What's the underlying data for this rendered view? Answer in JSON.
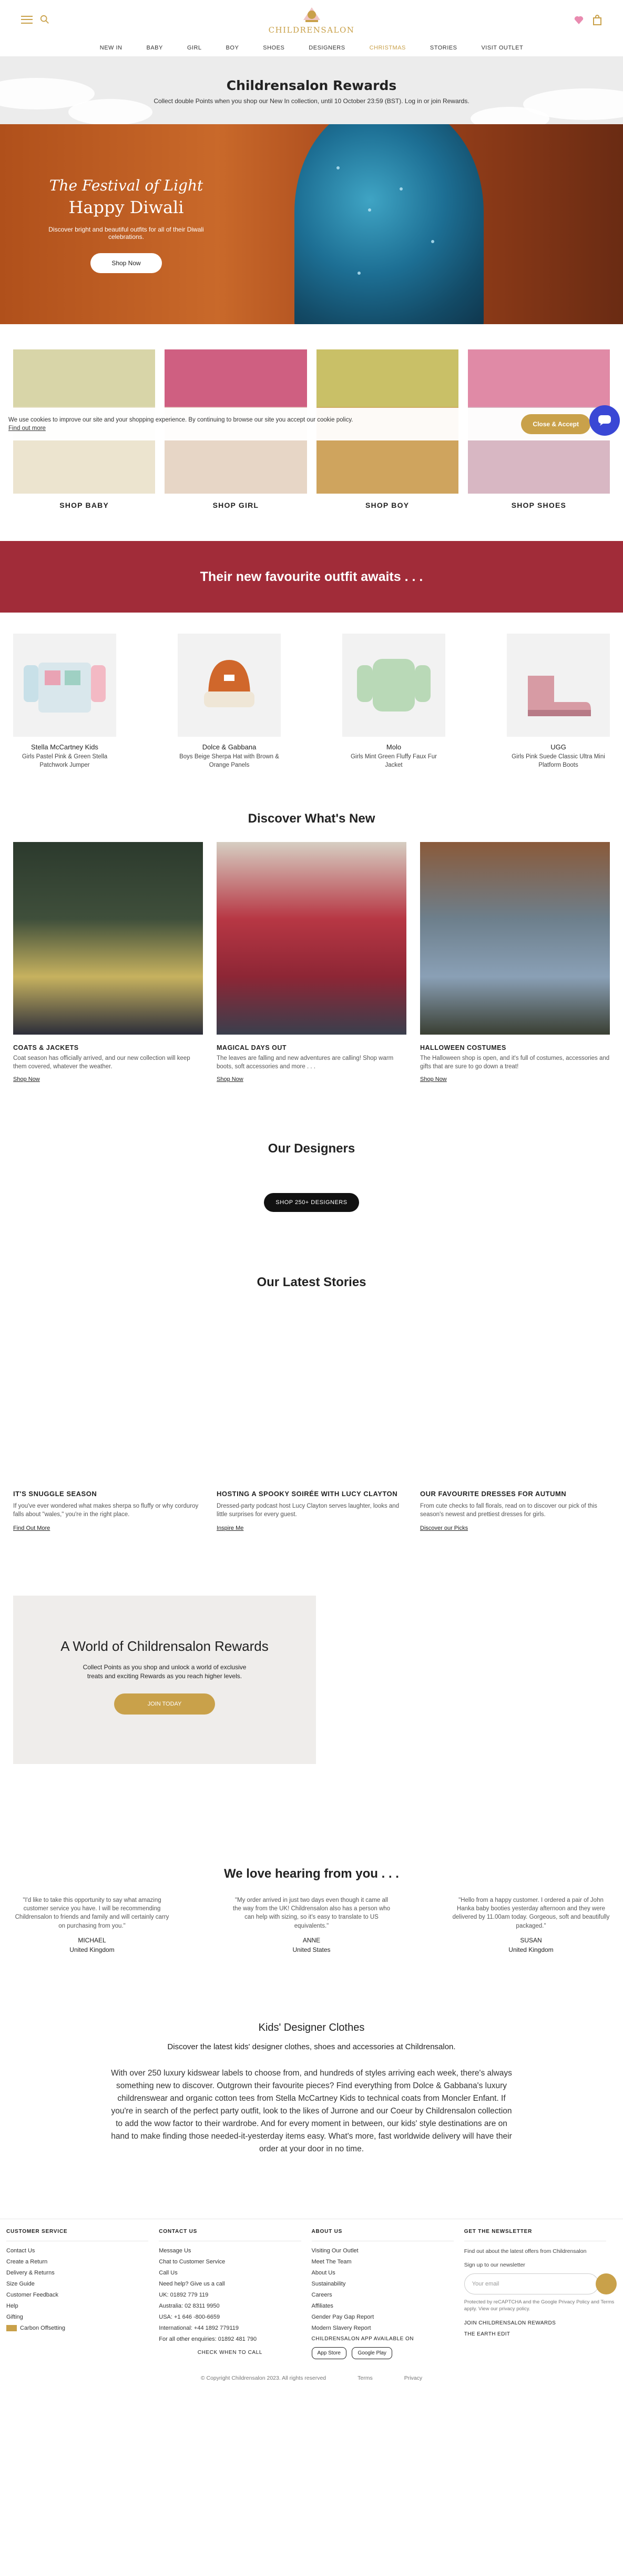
{
  "header": {
    "brand": "CHILDRENSALON",
    "nav": [
      "NEW IN",
      "BABY",
      "GIRL",
      "BOY",
      "SHOES",
      "DESIGNERS",
      "CHRISTMAS",
      "STORIES",
      "VISIT OUTLET"
    ],
    "icons": [
      "menu-icon",
      "search-icon",
      "wishlist-icon",
      "bag-icon"
    ]
  },
  "rewards_banner": {
    "title": "Childrensalon Rewards",
    "text": "Collect double Points when you shop our New In collection, until 10 October 23:59 (BST). Log in or join Rewards."
  },
  "hero": {
    "script": "The Festival of Light",
    "title": "Happy Diwali",
    "text": "Discover bright and beautiful outfits for all of their Diwali celebrations.",
    "button": "Shop Now"
  },
  "categories": [
    {
      "label": "SHOP BABY",
      "color": "#e6d9b8"
    },
    {
      "label": "SHOP GIRL",
      "color": "#d96a8a"
    },
    {
      "label": "SHOP BOY",
      "color": "#cfb455"
    },
    {
      "label": "SHOP SHOES",
      "color": "#e889a8"
    }
  ],
  "cookie": {
    "text": "We use cookies to improve our site and your shopping experience. By continuing to browse our site you accept our cookie policy.",
    "link": "Find out more",
    "button": "Close & Accept"
  },
  "outfit_band": {
    "title": "Their new favourite outfit awaits . . ."
  },
  "products": [
    {
      "brand": "Stella McCartney Kids",
      "name": "Girls Pastel Pink & Green Stella Patchwork Jumper"
    },
    {
      "brand": "Dolce & Gabbana",
      "name": "Boys Beige Sherpa Hat with Brown & Orange Panels"
    },
    {
      "brand": "Molo",
      "name": "Girls Mint Green Fluffy Faux Fur Jacket"
    },
    {
      "brand": "UGG",
      "name": "Girls Pink Suede Classic Ultra Mini Platform Boots"
    }
  ],
  "discover": {
    "title": "Discover What's New",
    "cards": [
      {
        "title": "COATS & JACKETS",
        "text": "Coat season has officially arrived, and our new collection will keep them covered, whatever the weather.",
        "link": "Shop Now"
      },
      {
        "title": "MAGICAL DAYS OUT",
        "text": "The leaves are falling and new adventures are calling! Shop warm boots, soft accessories and more . . .",
        "link": "Shop Now"
      },
      {
        "title": "HALLOWEEN COSTUMES",
        "text": "The Halloween shop is open, and it's full of costumes, accessories and gifts that are sure to go down a treat!",
        "link": "Shop Now"
      }
    ]
  },
  "designers": {
    "title": "Our Designers",
    "button": "SHOP 250+ DESIGNERS"
  },
  "stories": {
    "title": "Our Latest Stories",
    "items": [
      {
        "title": "IT'S SNUGGLE SEASON",
        "text": "If you've ever wondered what makes sherpa so fluffy or why corduroy falls about \"wales,\" you're in the right place.",
        "link": "Find Out More"
      },
      {
        "title": "HOSTING A SPOOKY SOIRÉE WITH LUCY CLAYTON",
        "text": "Dressed-party podcast host Lucy Clayton serves laughter, looks and little surprises for every guest.",
        "link": "Inspire Me"
      },
      {
        "title": "OUR FAVOURITE DRESSES FOR AUTUMN",
        "text": "From cute checks to fall florals, read on to discover our pick of this season's newest and prettiest dresses for girls.",
        "link": "Discover our Picks"
      }
    ]
  },
  "world": {
    "title": "A World of Childrensalon Rewards",
    "text": "Collect Points as you shop and unlock a world of exclusive treats and exciting Rewards as you reach higher levels.",
    "button": "JOIN TODAY"
  },
  "testimonials": {
    "title": "We love hearing from you . . .",
    "items": [
      {
        "quote": "\"I'd like to take this opportunity to say what amazing customer service you have. I will be recommending Childrensalon to friends and family and will certainly carry on purchasing from you.\"",
        "name": "MICHAEL",
        "place": "United Kingdom"
      },
      {
        "quote": "\"My order arrived in just two days even though it came all the way from the UK! Childrensalon also has a person who can help with sizing, so it's easy to translate to US equivalents.\"",
        "name": "ANNE",
        "place": "United States"
      },
      {
        "quote": "\"Hello from a happy customer. I ordered a pair of John Hanka baby booties yesterday afternoon and they were delivered by 11.00am today. Gorgeous, soft and beautifully packaged.\"",
        "name": "SUSAN",
        "place": "United Kingdom"
      }
    ]
  },
  "seo": {
    "title": "Kids' Designer Clothes",
    "sub": "Discover the latest kids' designer clothes, shoes and accessories at Childrensalon.",
    "body": "With over 250 luxury kidswear labels to choose from, and hundreds of styles arriving each week, there's always something new to discover. Outgrown their favourite pieces? Find everything from Dolce & Gabbana's luxury childrenswear and organic cotton tees from Stella McCartney Kids to technical coats from Moncler Enfant. If you're in search of the perfect party outfit, look to the likes of Jurrone and our Coeur by Childrensalon collection to add the wow factor to their wardrobe. And for every moment in between, our kids' style destinations are on hand to make finding those needed-it-yesterday items easy. What's more, fast worldwide delivery will have their order at your door in no time."
  },
  "footer": {
    "customer_service": {
      "title": "CUSTOMER SERVICE",
      "items": [
        "Contact Us",
        "Create a Return",
        "Delivery & Returns",
        "Size Guide",
        "Customer Feedback",
        "Help",
        "Gifting",
        "Carbon Offsetting"
      ]
    },
    "contact": {
      "title": "CONTACT US",
      "items": [
        "Message Us",
        "Chat to Customer Service",
        "Call Us",
        "Need help? Give us a call",
        "UK: 01892 779 119",
        "Australia: 02 8311 9950",
        "USA: +1 646 -800-6659",
        "International: +44 1892 779119",
        "For all other enquiries: 01892 481 790"
      ],
      "button": "CHECK WHEN TO CALL"
    },
    "about": {
      "title": "ABOUT US",
      "items": [
        "Visiting Our Outlet",
        "Meet The Team",
        "About Us",
        "Sustainability",
        "Careers",
        "Affiliates",
        "Gender Pay Gap Report",
        "Modern Slavery Report"
      ],
      "app_title": "CHILDRENSALON APP AVAILABLE ON",
      "apps": [
        "App Store",
        "Google Play"
      ]
    },
    "newsletter": {
      "title": "GET THE NEWSLETTER",
      "text": "Find out about the latest offers from Childrensalon",
      "signup": "Sign up to our newsletter",
      "placeholder": "Your email",
      "legal": "Protected by reCAPTCHA and the Google Privacy Policy and Terms apply. View our privacy policy.",
      "links": [
        "JOIN CHILDRENSALON REWARDS",
        "THE EARTH EDIT"
      ]
    },
    "bottom": [
      "© Copyright Childrensalon 2023. All rights reserved",
      "Terms",
      "Privacy"
    ]
  }
}
